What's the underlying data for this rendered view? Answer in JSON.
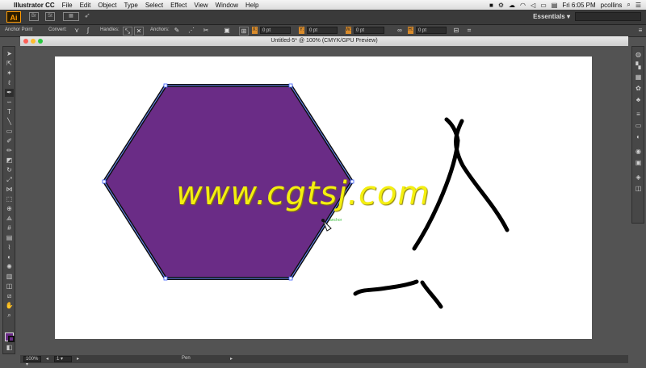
{
  "menubar": {
    "app": "Illustrator CC",
    "items": [
      "File",
      "Edit",
      "Object",
      "Type",
      "Select",
      "Effect",
      "View",
      "Window",
      "Help"
    ],
    "clock": "Fri 6:05 PM",
    "user": "pcollins"
  },
  "appbar": {
    "logo": "Ai",
    "workspace": "Essentials",
    "search_placeholder": ""
  },
  "control": {
    "selection_label": "Anchor Point",
    "convert_label": "Convert:",
    "handles_label": "Handles:",
    "anchors_label": "Anchors:",
    "x_label": "X:",
    "x_value": "0 pt",
    "y_label": "Y:",
    "y_value": "0 pt",
    "w_label": "W:",
    "w_value": "0 pt",
    "h_label": "H:",
    "h_value": "0 pt"
  },
  "document": {
    "title": "Untitled-5* @ 100% (CMYK/GPU Preview)"
  },
  "tools": [
    "selection",
    "direct-selection",
    "magic-wand",
    "lasso",
    "pen",
    "curvature",
    "type",
    "line-segment",
    "rectangle",
    "paintbrush",
    "pencil",
    "eraser",
    "rotate",
    "scale",
    "width",
    "free-transform",
    "shape-builder",
    "perspective",
    "mesh",
    "gradient",
    "eyedropper",
    "blend",
    "symbol-sprayer",
    "column-graph",
    "artboard",
    "slice",
    "hand",
    "zoom"
  ],
  "colors": {
    "fill": "#6a2c86",
    "stroke": "#111111",
    "watermark": "#f4ef10"
  },
  "canvas": {
    "watermark": "www.cgtsj.com",
    "pen_cursor_hint": "anchor"
  },
  "status": {
    "zoom": "100%",
    "artboard_index": "1",
    "current_tool": "Pen"
  },
  "panels": [
    "color",
    "color-guide",
    "swatches",
    "brushes",
    "symbols",
    "stroke",
    "gradient",
    "transparency",
    "appearance",
    "graphic-styles",
    "layers",
    "artboards"
  ]
}
